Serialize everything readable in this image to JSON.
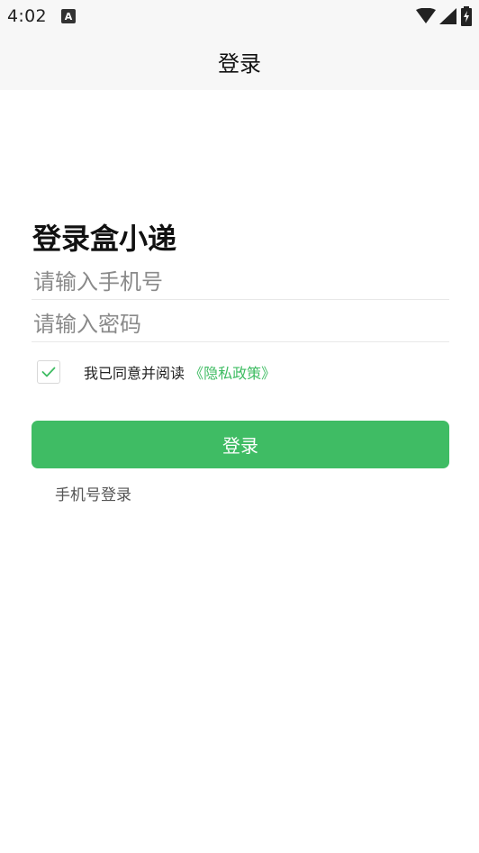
{
  "status_bar": {
    "time": "4:02",
    "notification_icon": "A",
    "icons": [
      "wifi-icon",
      "signal-icon",
      "battery-icon"
    ]
  },
  "header": {
    "title": "登录"
  },
  "main": {
    "heading": "登录盒小递",
    "phone_placeholder": "请输入手机号",
    "password_placeholder": "请输入密码",
    "agree_text": "我已同意并阅读",
    "privacy_link": "《隐私政策》",
    "agree_checked": true,
    "login_button": "登录",
    "alt_login": "手机号登录"
  },
  "colors": {
    "accent": "#3fbc64",
    "link": "#3ebc62",
    "header_bg": "#f7f7f7"
  }
}
